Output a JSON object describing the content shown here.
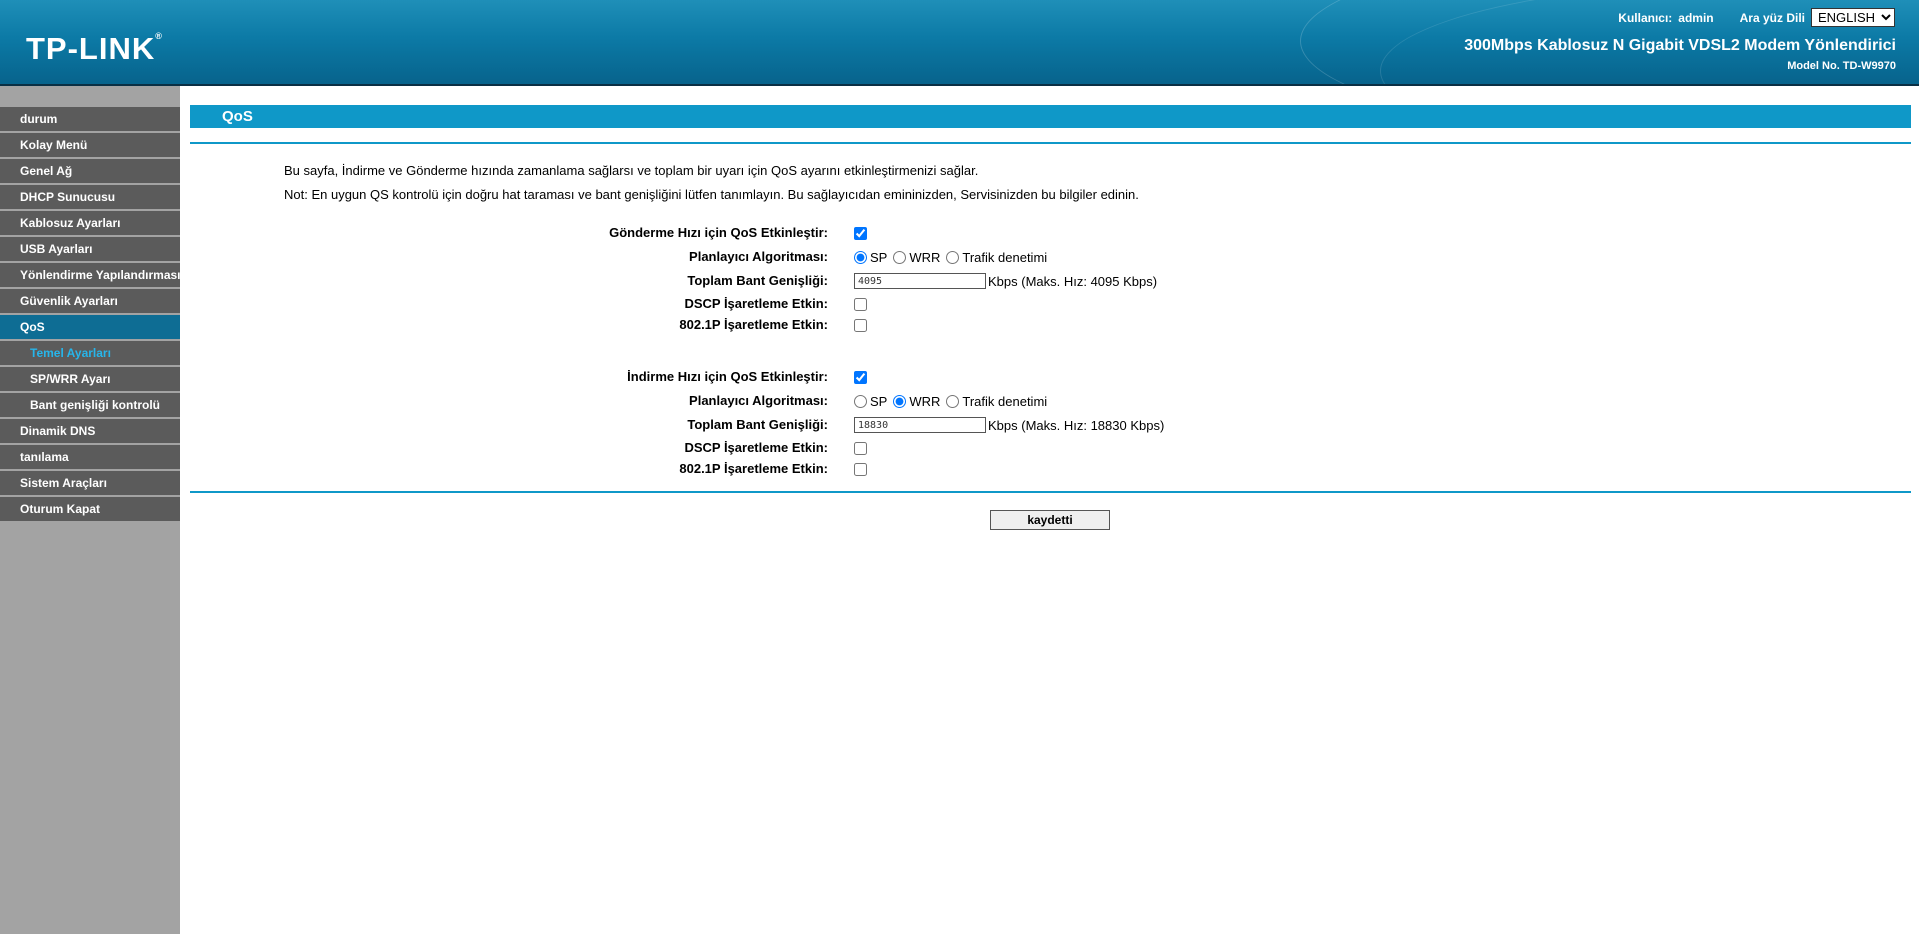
{
  "header": {
    "logo": "TP-LINK",
    "logo_mark": "®",
    "user_label": "Kullanıcı:",
    "user_name": "admin",
    "lang_label": "Ara yüz Dili",
    "lang_selected": "ENGLISH",
    "product_name": "300Mbps Kablosuz N Gigabit VDSL2 Modem Yönlendirici",
    "model_no": "Model No. TD-W9970"
  },
  "sidebar": {
    "items": [
      {
        "label": "durum"
      },
      {
        "label": "Kolay Menü"
      },
      {
        "label": "Genel Ağ"
      },
      {
        "label": "DHCP Sunucusu"
      },
      {
        "label": "Kablosuz Ayarları"
      },
      {
        "label": "USB Ayarları"
      },
      {
        "label": "Yönlendirme Yapılandırması"
      },
      {
        "label": "Güvenlik Ayarları"
      },
      {
        "label": "QoS"
      },
      {
        "label": "Temel Ayarları"
      },
      {
        "label": "SP/WRR Ayarı"
      },
      {
        "label": "Bant genişliği kontrolü"
      },
      {
        "label": "Dinamik DNS"
      },
      {
        "label": "tanılama"
      },
      {
        "label": "Sistem Araçları"
      },
      {
        "label": "Oturum Kapat"
      }
    ]
  },
  "page": {
    "title": "QoS",
    "desc1": "Bu sayfa, İndirme ve Gönderme hızında zamanlama sağlarsı ve toplam bir uyarı için QoS ayarını etkinleştirmenizi sağlar.",
    "desc2": "Not: En uygun QS kontrolü için doğru hat taraması ve bant genişliğini lütfen tanımlayın. Bu sağlayıcıdan emininizden, Servisinizden bu bilgiler edinin."
  },
  "upload": {
    "enable_label": "Gönderme Hızı için QoS Etkinleştir:",
    "enable_checked": true,
    "scheduler_label": "Planlayıcı Algoritması:",
    "scheduler_selected": "SP",
    "bandwidth_label": "Toplam Bant Genişliği:",
    "bandwidth_value": "4095",
    "bandwidth_note": "Kbps (Maks. Hız: 4095 Kbps)",
    "dscp_label": "DSCP İşaretleme Etkin:",
    "dscp_checked": false,
    "dot1p_label": "802.1P İşaretleme Etkin:",
    "dot1p_checked": false
  },
  "download": {
    "enable_label": "İndirme Hızı için QoS Etkinleştir:",
    "enable_checked": true,
    "scheduler_label": "Planlayıcı Algoritması:",
    "scheduler_selected": "WRR",
    "bandwidth_label": "Toplam Bant Genişliği:",
    "bandwidth_value": "18830",
    "bandwidth_note": "Kbps (Maks. Hız: 18830 Kbps)",
    "dscp_label": "DSCP İşaretleme Etkin:",
    "dscp_checked": false,
    "dot1p_label": "802.1P İşaretleme Etkin:",
    "dot1p_checked": false
  },
  "scheduler_options": {
    "sp": "SP",
    "wrr": "WRR",
    "traffic": "Trafik denetimi"
  },
  "save_label": "kaydetti",
  "colors": {
    "accent": "#0f98c8",
    "sidebar_item": "#5b5b5b",
    "sidebar_active": "#0e6d94",
    "sidebar_current": "#27b5ea"
  }
}
